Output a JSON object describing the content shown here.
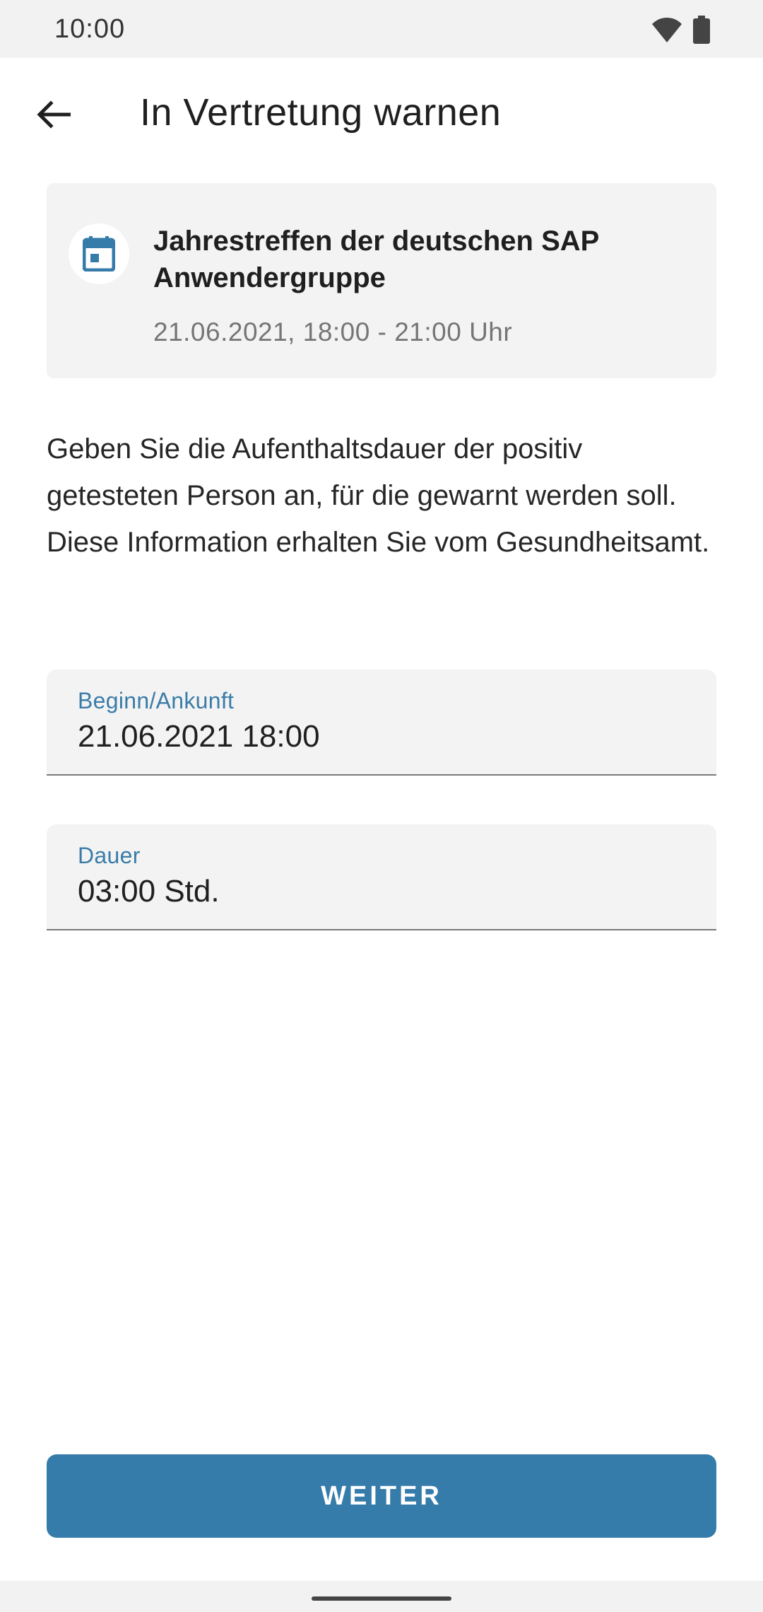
{
  "status_bar": {
    "time": "10:00",
    "icons": [
      "wifi-icon",
      "battery-icon"
    ]
  },
  "header": {
    "title": "In Vertretung warnen",
    "back_icon": "arrow-back-icon"
  },
  "event": {
    "icon": "calendar-icon",
    "title": "Jahrestreffen der deutschen SAP Anwendergruppe",
    "time": "21.06.2021, 18:00 - 21:00 Uhr"
  },
  "description": "Geben Sie die Aufenthaltsdauer der positiv getesteten Person an, für die gewarnt werden soll. Diese Information erhalten Sie vom Gesundheitsamt.",
  "fields": {
    "start": {
      "label": "Beginn/Ankunft",
      "value": "21.06.2021 18:00"
    },
    "duration": {
      "label": "Dauer",
      "value": "03:00 Std."
    }
  },
  "actions": {
    "next_label": "WEITER"
  },
  "colors": {
    "accent": "#367caa",
    "label": "#3a7ca8",
    "card_background": "#f3f3f3"
  }
}
